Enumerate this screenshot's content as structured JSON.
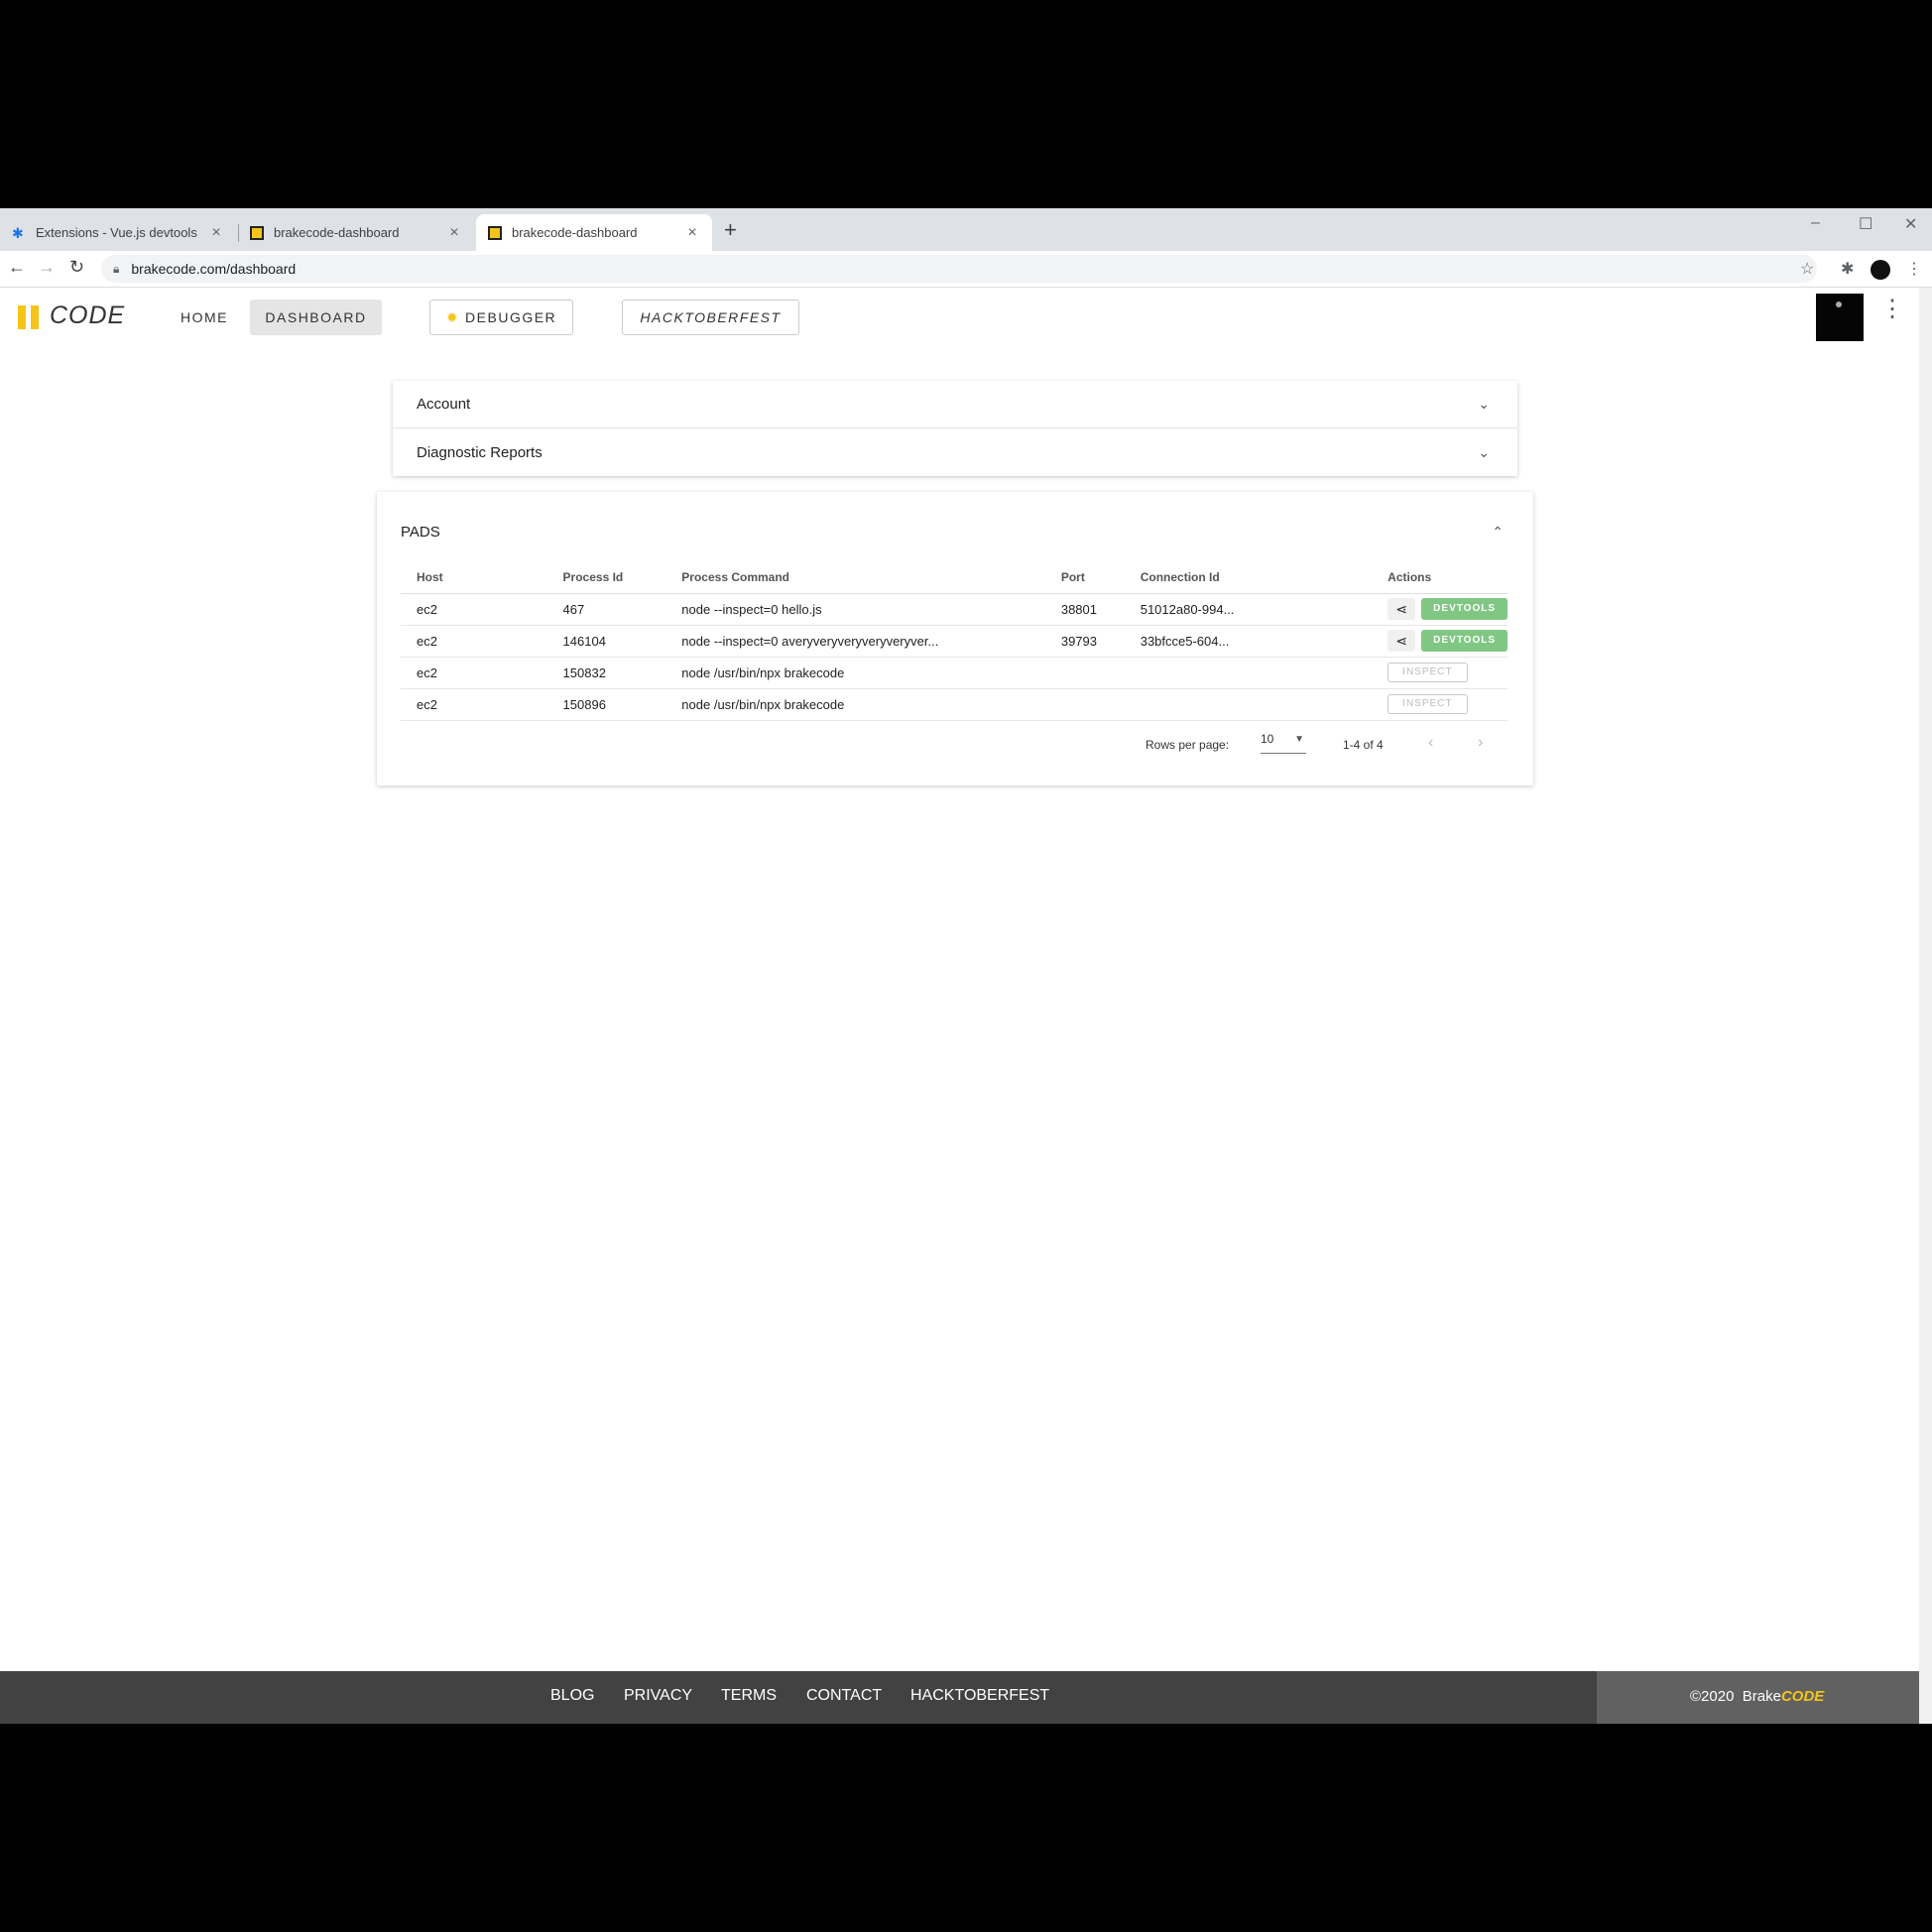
{
  "browser": {
    "tabs": [
      {
        "title": "Extensions - Vue.js devtools",
        "active": false
      },
      {
        "title": "brakecode-dashboard",
        "active": false
      },
      {
        "title": "brakecode-dashboard",
        "active": true
      }
    ],
    "url": "brakecode.com/dashboard"
  },
  "app": {
    "logo_text": "CODE",
    "nav": {
      "home": "HOME",
      "dashboard": "DASHBOARD",
      "debugger": "DEBUGGER",
      "hacktoberfest": "HACKTOBERFEST"
    },
    "brand_color": "#f5c518"
  },
  "panels": [
    {
      "label": "Account"
    },
    {
      "label": "Diagnostic Reports"
    }
  ],
  "pads": {
    "title": "PADS",
    "columns": [
      "Host",
      "Process Id",
      "Process Command",
      "Port",
      "Connection Id",
      "Actions"
    ],
    "rows": [
      {
        "host": "ec2",
        "pid": "467",
        "command": "node --inspect=0 hello.js",
        "port": "38801",
        "connection": "51012a80-994...",
        "action": "DEVTOOLS"
      },
      {
        "host": "ec2",
        "pid": "146104",
        "command": "node --inspect=0 averyveryveryveryveryver...",
        "port": "39793",
        "connection": "33bfcce5-604...",
        "action": "DEVTOOLS"
      },
      {
        "host": "ec2",
        "pid": "150832",
        "command": "node /usr/bin/npx brakecode",
        "port": "",
        "connection": "",
        "action": "INSPECT"
      },
      {
        "host": "ec2",
        "pid": "150896",
        "command": "node /usr/bin/npx brakecode",
        "port": "",
        "connection": "",
        "action": "INSPECT"
      }
    ],
    "rows_per_page_label": "Rows per page:",
    "rows_per_page": "10",
    "range": "1-4 of 4"
  },
  "footer": {
    "links": [
      "BLOG",
      "PRIVACY",
      "TERMS",
      "CONTACT",
      "HACKTOBERFEST"
    ],
    "copyright": "©2020",
    "brand_prefix": "Brake",
    "brand_suffix": "CODE"
  }
}
